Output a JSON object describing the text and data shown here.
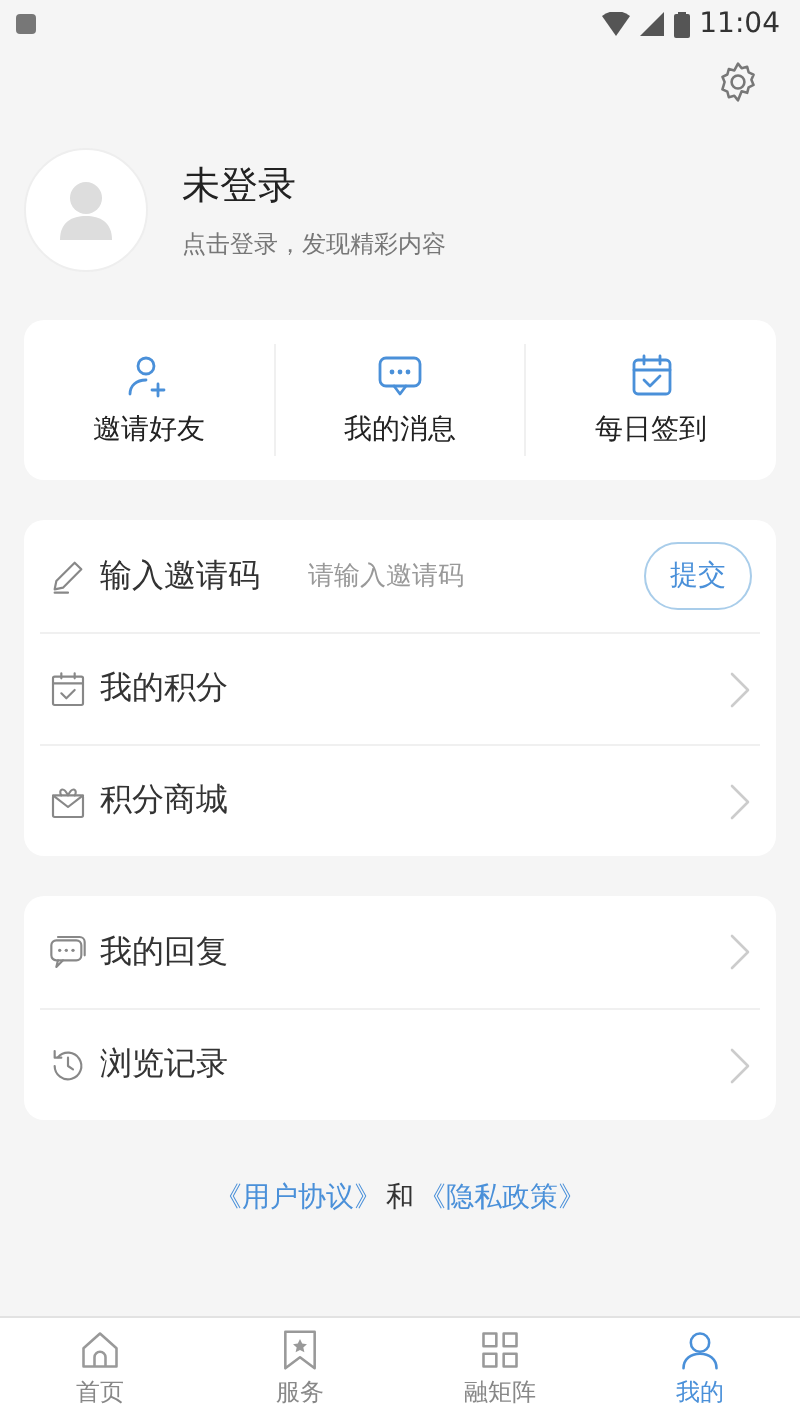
{
  "status_bar": {
    "time": "11:04"
  },
  "profile": {
    "name": "未登录",
    "subtitle": "点击登录，发现精彩内容"
  },
  "quick_actions": [
    "邀请好友",
    "我的消息",
    "每日签到"
  ],
  "invite": {
    "label": "输入邀请码",
    "placeholder": "请输入邀请码",
    "button": "提交"
  },
  "points_menu": [
    "我的积分",
    "积分商城"
  ],
  "activity_menu": [
    "我的回复",
    "浏览记录"
  ],
  "footer": {
    "links": [
      "《用户协议》",
      "《隐私政策》"
    ],
    "joiner": "和"
  },
  "tabs": [
    {
      "label": "首页",
      "selected": false
    },
    {
      "label": "服务",
      "selected": false
    },
    {
      "label": "融矩阵",
      "selected": false
    },
    {
      "label": "我的",
      "selected": true
    }
  ]
}
